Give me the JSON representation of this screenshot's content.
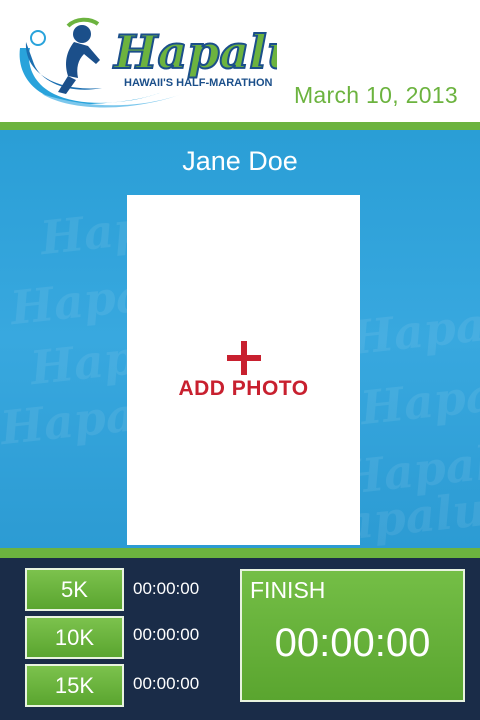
{
  "header": {
    "logo_title": "Hapalua",
    "logo_subtitle": "HAWAII'S HALF-MARATHON",
    "date": "March 10, 2013"
  },
  "runner": {
    "name": "Jane Doe"
  },
  "photo": {
    "add_label": "ADD PHOTO"
  },
  "splits": [
    {
      "label": "5K",
      "time": "00:00:00"
    },
    {
      "label": "10K",
      "time": "00:00:00"
    },
    {
      "label": "15K",
      "time": "00:00:00"
    }
  ],
  "finish": {
    "label": "FINISH",
    "time": "00:00:00"
  },
  "colors": {
    "brand_green": "#6cb33f",
    "brand_blue": "#2a9ed6",
    "accent_red": "#c8202f",
    "footer_navy": "#1a2c48"
  }
}
